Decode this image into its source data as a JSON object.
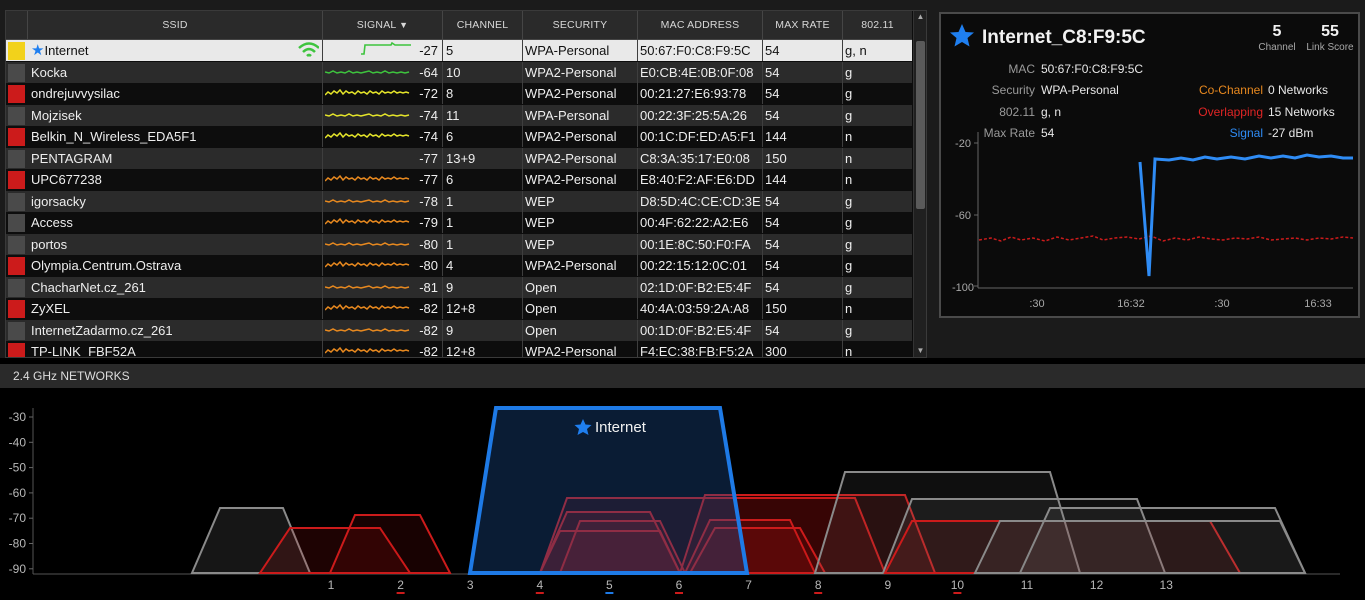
{
  "table": {
    "columns": [
      "SSID",
      "SIGNAL",
      "CHANNEL",
      "SECURITY",
      "MAC ADDRESS",
      "MAX RATE",
      "802.11"
    ],
    "sort_icon": "sort-descending-icon",
    "rows": [
      {
        "ssid": "Internet",
        "signal": "-27",
        "channel": "5",
        "security": "WPA-Personal",
        "mac": "50:67:F0:C8:F9:5C",
        "rate": "54",
        "mode": "g, n",
        "color": "#f2d21b",
        "spark": "#3ec43e",
        "star": true,
        "wifi": true,
        "selected": true
      },
      {
        "ssid": "Kocka",
        "signal": "-64",
        "channel": "10",
        "security": "WPA2-Personal",
        "mac": "E0:CB:4E:0B:0F:08",
        "rate": "54",
        "mode": "g",
        "color": "#4a4a4a",
        "spark": "#3ec43e"
      },
      {
        "ssid": "ondrejuvvysilac",
        "signal": "-72",
        "channel": "8",
        "security": "WPA2-Personal",
        "mac": "00:21:27:E6:93:78",
        "rate": "54",
        "mode": "g",
        "color": "#cc1b1b",
        "spark": "#e5e52a"
      },
      {
        "ssid": "Mojzisek",
        "signal": "-74",
        "channel": "11",
        "security": "WPA-Personal",
        "mac": "00:22:3F:25:5A:26",
        "rate": "54",
        "mode": "g",
        "color": "#4a4a4a",
        "spark": "#e5e52a"
      },
      {
        "ssid": "Belkin_N_Wireless_EDA5F1",
        "signal": "-74",
        "channel": "6",
        "security": "WPA2-Personal",
        "mac": "00:1C:DF:ED:A5:F1",
        "rate": "144",
        "mode": "n",
        "color": "#cc1b1b",
        "spark": "#e5e52a"
      },
      {
        "ssid": "PENTAGRAM",
        "signal": "-77",
        "channel": "13+9",
        "security": "WPA2-Personal",
        "mac": "C8:3A:35:17:E0:08",
        "rate": "150",
        "mode": "n",
        "color": "#4a4a4a",
        "spark": ""
      },
      {
        "ssid": "UPC677238",
        "signal": "-77",
        "channel": "6",
        "security": "WPA2-Personal",
        "mac": "E8:40:F2:AF:E6:DD",
        "rate": "144",
        "mode": "n",
        "color": "#cc1b1b",
        "spark": "#e8891f"
      },
      {
        "ssid": "igorsacky",
        "signal": "-78",
        "channel": "1",
        "security": "WEP",
        "mac": "D8:5D:4C:CE:CD:3E",
        "rate": "54",
        "mode": "g",
        "color": "#4a4a4a",
        "spark": "#e8891f"
      },
      {
        "ssid": "Access",
        "signal": "-79",
        "channel": "1",
        "security": "WEP",
        "mac": "00:4F:62:22:A2:E6",
        "rate": "54",
        "mode": "g",
        "color": "#4a4a4a",
        "spark": "#e8891f"
      },
      {
        "ssid": "portos",
        "signal": "-80",
        "channel": "1",
        "security": "WEP",
        "mac": "00:1E:8C:50:F0:FA",
        "rate": "54",
        "mode": "g",
        "color": "#4a4a4a",
        "spark": "#e8891f"
      },
      {
        "ssid": "Olympia.Centrum.Ostrava",
        "signal": "-80",
        "channel": "4",
        "security": "WPA2-Personal",
        "mac": "00:22:15:12:0C:01",
        "rate": "54",
        "mode": "g",
        "color": "#cc1b1b",
        "spark": "#e8891f"
      },
      {
        "ssid": "ChacharNet.cz_261",
        "signal": "-81",
        "channel": "9",
        "security": "Open",
        "mac": "02:1D:0F:B2:E5:4F",
        "rate": "54",
        "mode": "g",
        "color": "#4a4a4a",
        "spark": "#e8891f"
      },
      {
        "ssid": "ZyXEL",
        "signal": "-82",
        "channel": "12+8",
        "security": "Open",
        "mac": "40:4A:03:59:2A:A8",
        "rate": "150",
        "mode": "n",
        "color": "#cc1b1b",
        "spark": "#e8891f"
      },
      {
        "ssid": "InternetZadarmo.cz_261",
        "signal": "-82",
        "channel": "9",
        "security": "Open",
        "mac": "00:1D:0F:B2:E5:4F",
        "rate": "54",
        "mode": "g",
        "color": "#4a4a4a",
        "spark": "#e8891f"
      },
      {
        "ssid": "TP-LINK_FBF52A",
        "signal": "-82",
        "channel": "12+8",
        "security": "WPA2-Personal",
        "mac": "F4:EC:38:FB:F5:2A",
        "rate": "300",
        "mode": "n",
        "color": "#cc1b1b",
        "spark": "#e8891f"
      }
    ]
  },
  "detail": {
    "title": "Internet_C8:F9:5C",
    "channel_value": "5",
    "channel_label": "Channel",
    "score_value": "55",
    "score_label": "Link Score",
    "mac_label": "MAC",
    "mac_value": "50:67:F0:C8:F9:5C",
    "security_label": "Security",
    "security_value": "WPA-Personal",
    "mode_label": "802.11",
    "mode_value": "g, n",
    "rate_label": "Max Rate",
    "rate_value": "54",
    "cochannel_label": "Co-Channel",
    "cochannel_value": "0 Networks",
    "overlap_label": "Overlapping",
    "overlap_value": "15 Networks",
    "signal_label": "Signal",
    "signal_value": "-27 dBm",
    "chart": {
      "y_ticks": [
        "-20",
        "-60",
        "-100"
      ],
      "x_ticks": [
        ":30",
        "16:32",
        ":30",
        "16:33"
      ],
      "signal_color": "#2f8cf5",
      "noise_color": "#cc1b1b"
    }
  },
  "graph": {
    "title": "2.4 GHz NETWORKS",
    "y_ticks": [
      "-30",
      "-40",
      "-50",
      "-60",
      "-70",
      "-80",
      "-90"
    ],
    "x_ticks": [
      "1",
      "2",
      "3",
      "4",
      "5",
      "6",
      "7",
      "8",
      "9",
      "10",
      "11",
      "12",
      "13"
    ],
    "highlight_label": "Internet",
    "highlight_color": "#1e7ae6"
  }
}
